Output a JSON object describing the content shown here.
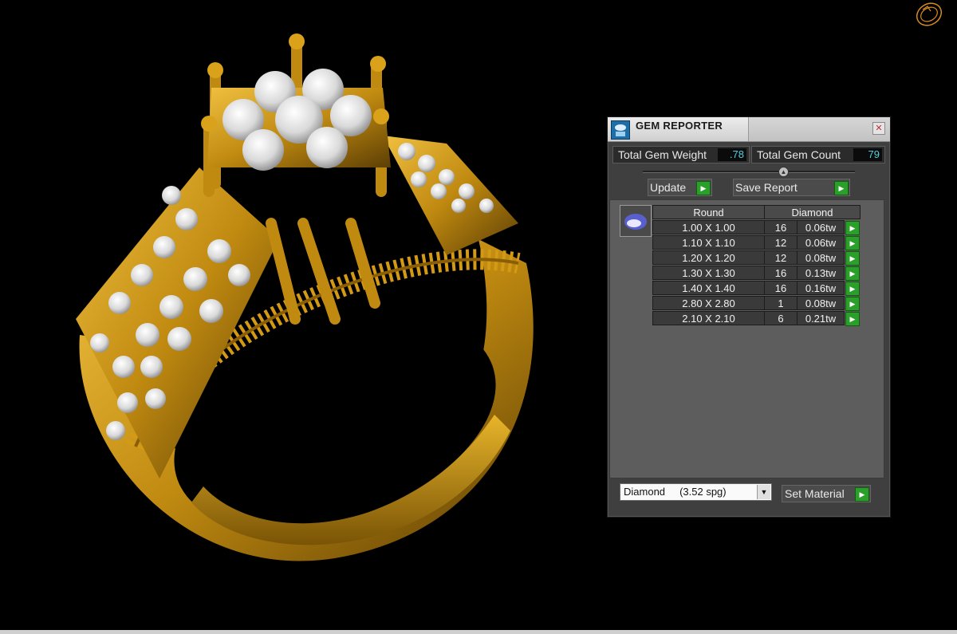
{
  "window": {
    "title": "GEM REPORTER",
    "close_glyph": "✕"
  },
  "stats": {
    "weight_label": "Total Gem Weight",
    "weight_value": ".78",
    "count_label": "Total Gem Count",
    "count_value": "79"
  },
  "buttons": {
    "update": "Update",
    "save_report": "Save Report",
    "set_material": "Set Material",
    "go_glyph": "▶"
  },
  "table": {
    "shape_header": "Round",
    "material_header": "Diamond",
    "rows": [
      {
        "size": "1.00 X 1.00",
        "count": "16",
        "weight": "0.06tw"
      },
      {
        "size": "1.10 X 1.10",
        "count": "12",
        "weight": "0.06tw"
      },
      {
        "size": "1.20 X 1.20",
        "count": "12",
        "weight": "0.08tw"
      },
      {
        "size": "1.30 X 1.30",
        "count": "16",
        "weight": "0.13tw"
      },
      {
        "size": "1.40 X 1.40",
        "count": "16",
        "weight": "0.16tw"
      },
      {
        "size": "2.80 X 2.80",
        "count": "1",
        "weight": "0.08tw"
      },
      {
        "size": "2.10 X 2.10",
        "count": "6",
        "weight": "0.21tw"
      }
    ]
  },
  "material": {
    "selected": "Diamond     (3.52 spg)"
  },
  "icons": {
    "app": "gem-reporter-app-icon",
    "gem_thumb": "oval-gem-icon",
    "corner": "ring-outline-icon",
    "slider": "slider-knob-icon"
  },
  "colors": {
    "gold": "#c9961a",
    "gem": "#e6e6e6",
    "accent_green": "#2aa02a",
    "value_cyan": "#4fd0e0"
  }
}
